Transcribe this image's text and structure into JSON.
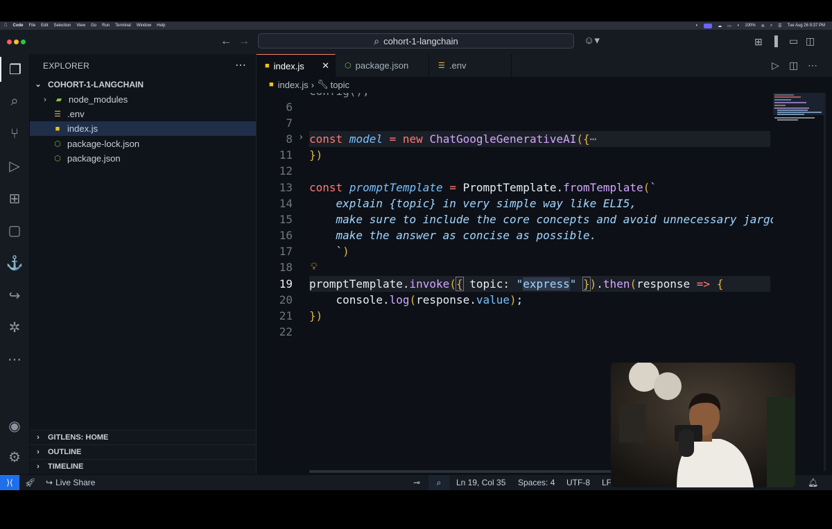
{
  "menubar": {
    "items": [
      "Code",
      "File",
      "Edit",
      "Selection",
      "View",
      "Go",
      "Run",
      "Terminal",
      "Window",
      "Help"
    ],
    "battery": "100%",
    "datetime": "Tue Aug 26  9:37 PM"
  },
  "title": {
    "command_center": "cohort-1-langchain"
  },
  "explorer": {
    "title": "EXPLORER",
    "folder": "COHORT-1-LANGCHAIN",
    "items": [
      {
        "label": "node_modules",
        "kind": "folder"
      },
      {
        "label": ".env",
        "kind": "env"
      },
      {
        "label": "index.js",
        "kind": "js"
      },
      {
        "label": "package-lock.json",
        "kind": "json"
      },
      {
        "label": "package.json",
        "kind": "json"
      }
    ],
    "sections": [
      "GITLENS: HOME",
      "OUTLINE",
      "TIMELINE"
    ]
  },
  "tabs": [
    {
      "label": "index.js",
      "icon": "JS"
    },
    {
      "label": "package.json",
      "icon": "{}"
    },
    {
      "label": ".env",
      "icon": "≡"
    }
  ],
  "breadcrumb": {
    "file": "index.js",
    "symbol": "topic"
  },
  "code": {
    "line_numbers": [
      "6",
      "7",
      "8",
      "11",
      "12",
      "13",
      "14",
      "15",
      "16",
      "17",
      "18",
      "19",
      "20",
      "21",
      "22"
    ],
    "partial_top": "config();"
  },
  "statusbar": {
    "live_share": "Live Share",
    "position": "Ln 19, Col 35",
    "spaces": "Spaces: 4",
    "encoding": "UTF-8",
    "eol": "LF"
  },
  "colors": {
    "keyword": "#ff7b72",
    "function": "#d2a8ff",
    "string": "#a5d6ff",
    "accent": "#1f2f4a"
  }
}
